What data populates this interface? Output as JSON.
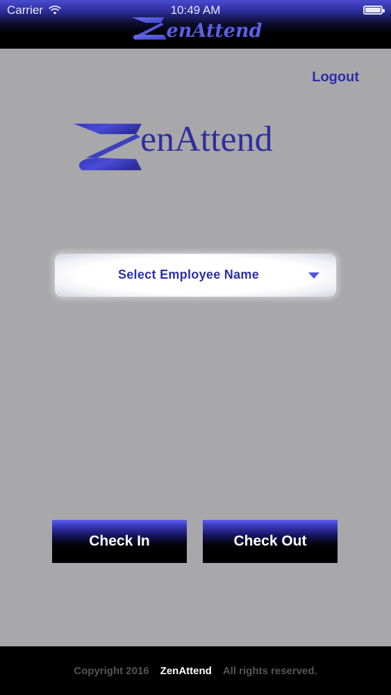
{
  "status_bar": {
    "carrier": "Carrier",
    "time": "10:49 AM",
    "wifi_icon": "wifi-icon",
    "battery_icon": "battery-icon"
  },
  "nav": {
    "logo_text": "enAttend"
  },
  "header": {
    "logout_label": "Logout"
  },
  "main": {
    "logo_text": "enAttend",
    "employee_select": {
      "placeholder": "Select Employee Name",
      "caret_icon": "triangle-down-icon"
    },
    "check_in_label": "Check In",
    "check_out_label": "Check Out"
  },
  "footer": {
    "copyright": "Copyright 2016",
    "brand": "ZenAttend",
    "rights": "All rights reserved."
  },
  "colors": {
    "accent": "#2b2fa8",
    "logo_blue": "#2e2f9e",
    "nav_gradient_top": "#4a4bd0",
    "background": "#a8a7aa",
    "footer_bg": "#000000"
  }
}
